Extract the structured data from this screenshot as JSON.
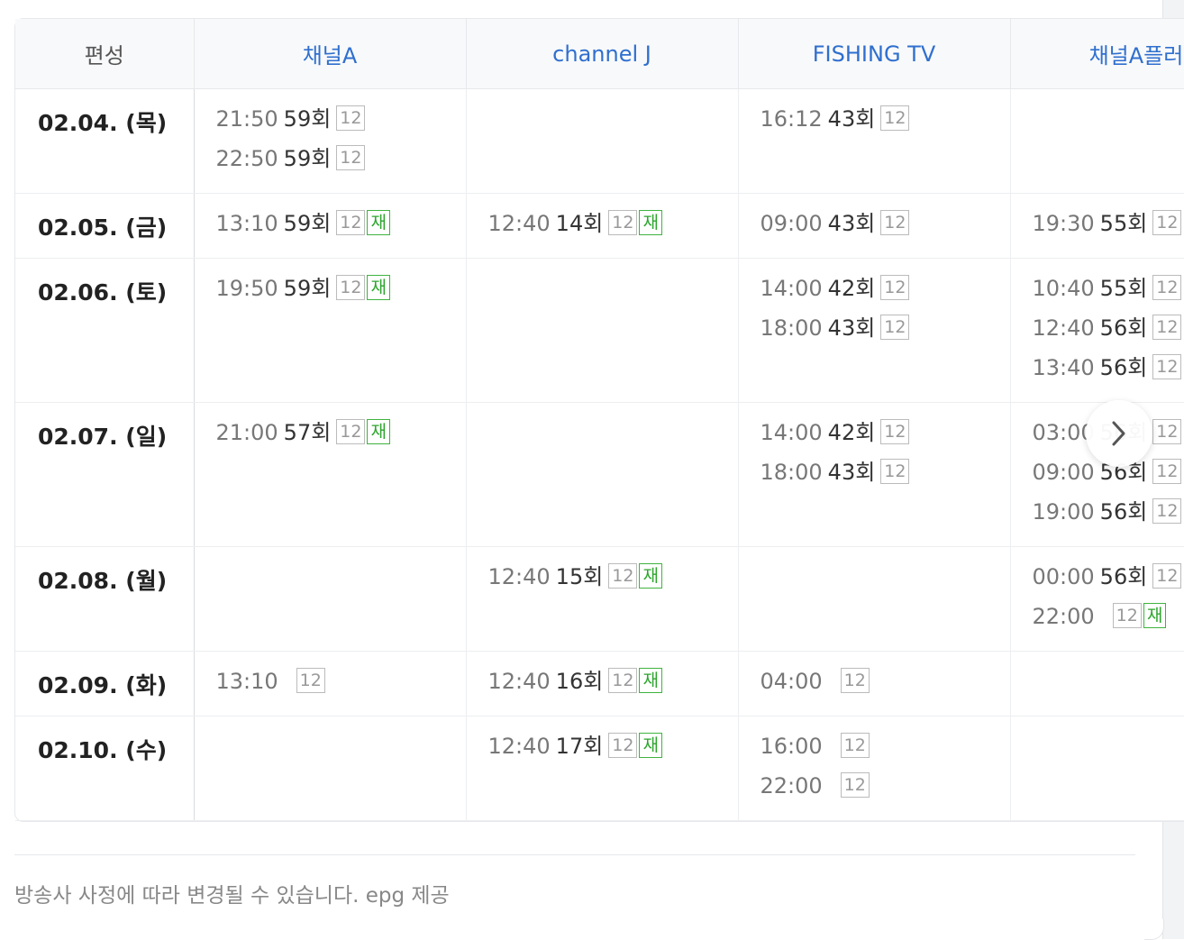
{
  "header": {
    "corner_label": "편성",
    "channels": [
      "채널A",
      "channel J",
      "FISHING TV",
      "채널A플러스"
    ]
  },
  "rows": [
    {
      "date": "02.04. (목)",
      "cells": [
        [
          {
            "time": "21:50",
            "ep": "59회",
            "rating": "12",
            "re": false
          },
          {
            "time": "22:50",
            "ep": "59회",
            "rating": "12",
            "re": false
          }
        ],
        [],
        [
          {
            "time": "16:12",
            "ep": "43회",
            "rating": "12",
            "re": false
          }
        ],
        []
      ]
    },
    {
      "date": "02.05. (금)",
      "cells": [
        [
          {
            "time": "13:10",
            "ep": "59회",
            "rating": "12",
            "re": true
          }
        ],
        [
          {
            "time": "12:40",
            "ep": "14회",
            "rating": "12",
            "re": true
          }
        ],
        [
          {
            "time": "09:00",
            "ep": "43회",
            "rating": "12",
            "re": false
          }
        ],
        [
          {
            "time": "19:30",
            "ep": "55회",
            "rating": "12",
            "re": false
          }
        ]
      ]
    },
    {
      "date": "02.06. (토)",
      "cells": [
        [
          {
            "time": "19:50",
            "ep": "59회",
            "rating": "12",
            "re": true
          }
        ],
        [],
        [
          {
            "time": "14:00",
            "ep": "42회",
            "rating": "12",
            "re": false
          },
          {
            "time": "18:00",
            "ep": "43회",
            "rating": "12",
            "re": false
          }
        ],
        [
          {
            "time": "10:40",
            "ep": "55회",
            "rating": "12",
            "re": false
          },
          {
            "time": "12:40",
            "ep": "56회",
            "rating": "12",
            "re": false
          },
          {
            "time": "13:40",
            "ep": "56회",
            "rating": "12",
            "re": false
          }
        ]
      ]
    },
    {
      "date": "02.07. (일)",
      "cells": [
        [
          {
            "time": "21:00",
            "ep": "57회",
            "rating": "12",
            "re": true
          }
        ],
        [],
        [
          {
            "time": "14:00",
            "ep": "42회",
            "rating": "12",
            "re": false
          },
          {
            "time": "18:00",
            "ep": "43회",
            "rating": "12",
            "re": false
          }
        ],
        [
          {
            "time": "03:00",
            "ep": "56회",
            "rating": "12",
            "re": false
          },
          {
            "time": "09:00",
            "ep": "56회",
            "rating": "12",
            "re": false
          },
          {
            "time": "19:00",
            "ep": "56회",
            "rating": "12",
            "re": false
          }
        ]
      ]
    },
    {
      "date": "02.08. (월)",
      "cells": [
        [],
        [
          {
            "time": "12:40",
            "ep": "15회",
            "rating": "12",
            "re": true
          }
        ],
        [],
        [
          {
            "time": "00:00",
            "ep": "56회",
            "rating": "12",
            "re": false
          },
          {
            "time": "22:00",
            "ep": "",
            "rating": "12",
            "re": true
          }
        ]
      ]
    },
    {
      "date": "02.09. (화)",
      "cells": [
        [
          {
            "time": "13:10",
            "ep": "",
            "rating": "12",
            "re": false
          }
        ],
        [
          {
            "time": "12:40",
            "ep": "16회",
            "rating": "12",
            "re": true
          }
        ],
        [
          {
            "time": "04:00",
            "ep": "",
            "rating": "12",
            "re": false
          }
        ],
        []
      ]
    },
    {
      "date": "02.10. (수)",
      "cells": [
        [],
        [
          {
            "time": "12:40",
            "ep": "17회",
            "rating": "12",
            "re": true
          }
        ],
        [
          {
            "time": "16:00",
            "ep": "",
            "rating": "12",
            "re": false
          },
          {
            "time": "22:00",
            "ep": "",
            "rating": "12",
            "re": false
          }
        ],
        []
      ]
    }
  ],
  "rerun_label": "재",
  "next_button_icon": "chevron-right-icon",
  "footer": {
    "notice": "방송사 사정에 따라 변경될 수 있습니다. epg 제공"
  }
}
